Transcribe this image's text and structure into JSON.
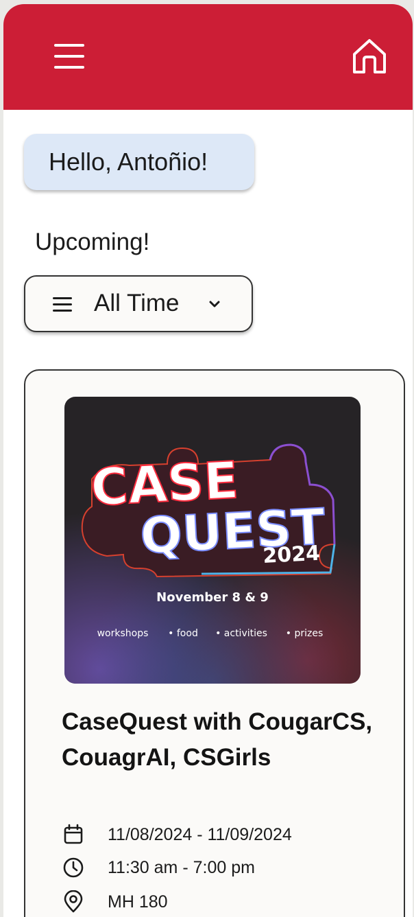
{
  "header": {
    "menu_icon": "menu-icon",
    "home_icon": "home-icon",
    "accent": "#cc1e36"
  },
  "greeting": "Hello, Antoñio!",
  "section_title": "Upcoming!",
  "filter": {
    "selected": "All Time",
    "icon": "list-icon",
    "chevron": "chevron-down-icon"
  },
  "events": [
    {
      "poster": {
        "title_line1": "CASE",
        "title_line2": "QUEST",
        "year": "2024",
        "date": "November 8 & 9",
        "tags": [
          "workshops",
          "• food",
          "• activities",
          "• prizes"
        ]
      },
      "title": "CaseQuest with CougarCS, CouagrAI, CSGirls",
      "date_range": "11/08/2024 - 11/09/2024",
      "time_range": "11:30 am - 7:00 pm",
      "location": "MH 180"
    }
  ]
}
